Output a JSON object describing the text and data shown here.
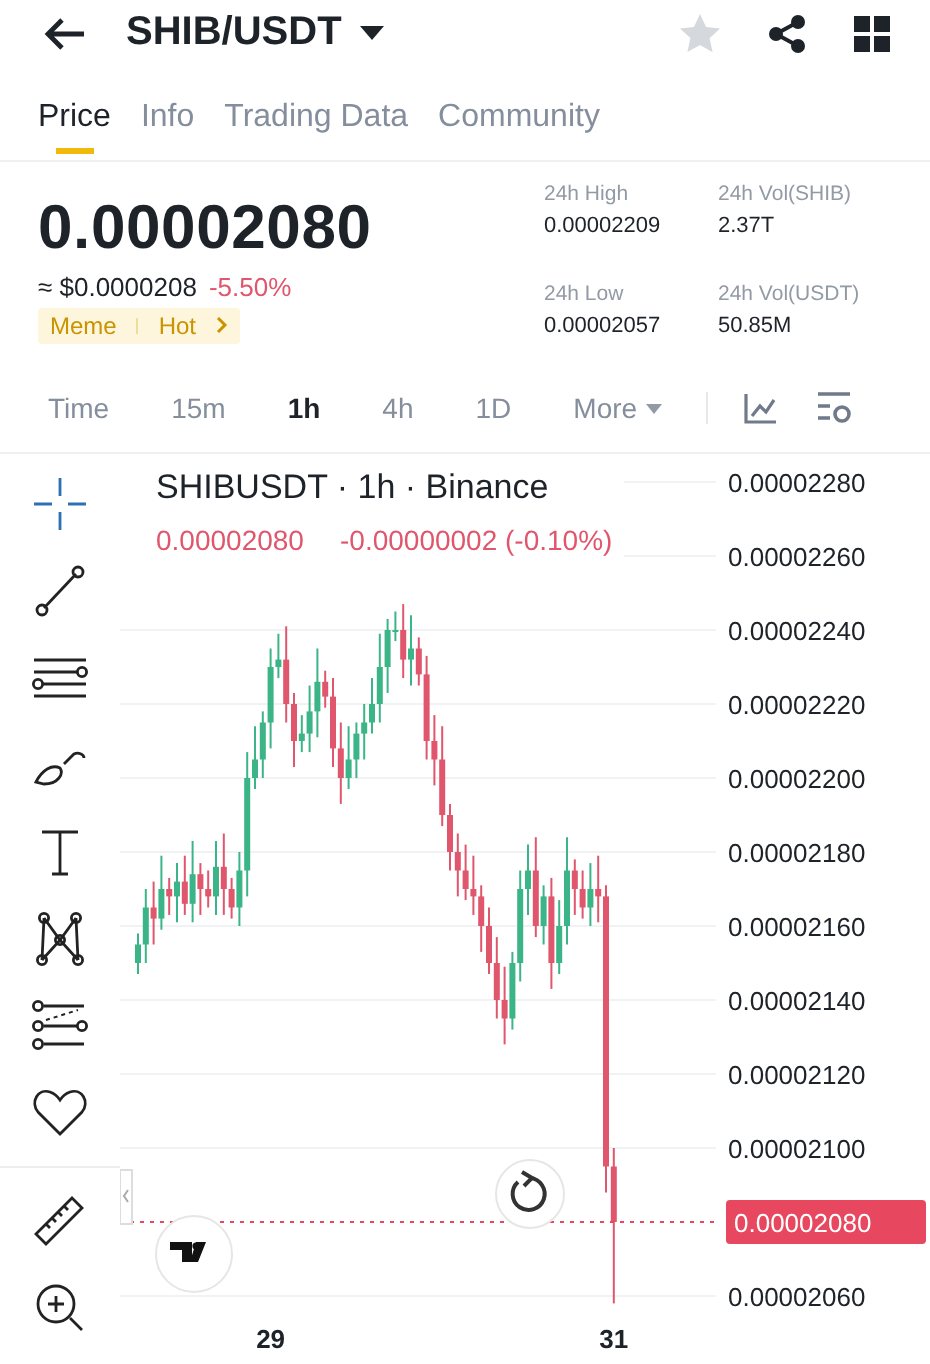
{
  "header": {
    "title": "SHIB/USDT",
    "favorite": false
  },
  "tabs": [
    {
      "label": "Price",
      "selected": true
    },
    {
      "label": "Info",
      "selected": false
    },
    {
      "label": "Trading Data",
      "selected": false
    },
    {
      "label": "Community",
      "selected": false
    }
  ],
  "price": {
    "last": "0.00002080",
    "fiat": "≈ $0.0000208",
    "change": "-5.50%",
    "tags": [
      "Meme",
      "Hot"
    ]
  },
  "stats": [
    {
      "label": "24h High",
      "value": "0.00002209"
    },
    {
      "label": "24h Vol(SHIB)",
      "value": "2.37T"
    },
    {
      "label": "24h Low",
      "value": "0.00002057"
    },
    {
      "label": "24h Vol(USDT)",
      "value": "50.85M"
    }
  ],
  "intervals": [
    {
      "label": "Time",
      "selected": false
    },
    {
      "label": "15m",
      "selected": false
    },
    {
      "label": "1h",
      "selected": true
    },
    {
      "label": "4h",
      "selected": false
    },
    {
      "label": "1D",
      "selected": false
    }
  ],
  "more": "More",
  "chart": {
    "legend_title": "SHIBUSDT · 1h · Binance",
    "legend_price": "0.00002080",
    "legend_change": "-0.00000002 (-0.10%)",
    "chart_data": {
      "type": "candlestick",
      "categories": [
        null,
        null,
        null,
        null,
        null,
        null,
        null,
        null,
        null,
        null,
        null,
        null,
        null,
        null,
        null,
        null,
        null,
        "29",
        null,
        null,
        null,
        null,
        null,
        null,
        null,
        null,
        null,
        null,
        null,
        null,
        null,
        null,
        null,
        null,
        null,
        null,
        null,
        null,
        null,
        null,
        null,
        null,
        null,
        null,
        null,
        null,
        null,
        null,
        null,
        null,
        null,
        null,
        null,
        null,
        null,
        null,
        null,
        null,
        null,
        null,
        null,
        "31"
      ],
      "ohlc": [
        [
          2.15e-05,
          2.158e-05,
          2.147e-05,
          2.155e-05
        ],
        [
          2.155e-05,
          2.17e-05,
          2.15e-05,
          2.165e-05
        ],
        [
          2.165e-05,
          2.172e-05,
          2.155e-05,
          2.162e-05
        ],
        [
          2.162e-05,
          2.179e-05,
          2.159e-05,
          2.17e-05
        ],
        [
          2.17e-05,
          2.173e-05,
          2.163e-05,
          2.168e-05
        ],
        [
          2.168e-05,
          2.177e-05,
          2.161e-05,
          2.172e-05
        ],
        [
          2.172e-05,
          2.179e-05,
          2.163e-05,
          2.166e-05
        ],
        [
          2.166e-05,
          2.183e-05,
          2.161e-05,
          2.174e-05
        ],
        [
          2.174e-05,
          2.177e-05,
          2.163e-05,
          2.17e-05
        ],
        [
          2.17e-05,
          2.175e-05,
          2.165e-05,
          2.168e-05
        ],
        [
          2.168e-05,
          2.183e-05,
          2.163e-05,
          2.176e-05
        ],
        [
          2.176e-05,
          2.185e-05,
          2.163e-05,
          2.17e-05
        ],
        [
          2.17e-05,
          2.173e-05,
          2.162e-05,
          2.165e-05
        ],
        [
          2.165e-05,
          2.18e-05,
          2.16e-05,
          2.175e-05
        ],
        [
          2.175e-05,
          2.207e-05,
          2.168e-05,
          2.2e-05
        ],
        [
          2.2e-05,
          2.214e-05,
          2.197e-05,
          2.205e-05
        ],
        [
          2.205e-05,
          2.218e-05,
          2.2e-05,
          2.215e-05
        ],
        [
          2.215e-05,
          2.235e-05,
          2.208e-05,
          2.23e-05
        ],
        [
          2.23e-05,
          2.239e-05,
          2.227e-05,
          2.232e-05
        ],
        [
          2.232e-05,
          2.241e-05,
          2.215e-05,
          2.22e-05
        ],
        [
          2.22e-05,
          2.223e-05,
          2.203e-05,
          2.21e-05
        ],
        [
          2.21e-05,
          2.217e-05,
          2.207e-05,
          2.212e-05
        ],
        [
          2.212e-05,
          2.225e-05,
          2.207e-05,
          2.218e-05
        ],
        [
          2.218e-05,
          2.235e-05,
          2.211e-05,
          2.226e-05
        ],
        [
          2.226e-05,
          2.229e-05,
          2.219e-05,
          2.222e-05
        ],
        [
          2.222e-05,
          2.227e-05,
          2.203e-05,
          2.208e-05
        ],
        [
          2.208e-05,
          2.215e-05,
          2.193e-05,
          2.2e-05
        ],
        [
          2.2e-05,
          2.214e-05,
          2.197e-05,
          2.205e-05
        ],
        [
          2.205e-05,
          2.215e-05,
          2.2e-05,
          2.212e-05
        ],
        [
          2.212e-05,
          2.22e-05,
          2.205e-05,
          2.215e-05
        ],
        [
          2.215e-05,
          2.227e-05,
          2.212e-05,
          2.22e-05
        ],
        [
          2.22e-05,
          2.239e-05,
          2.215e-05,
          2.23e-05
        ],
        [
          2.23e-05,
          2.243e-05,
          2.223e-05,
          2.24e-05
        ],
        [
          2.24e-05,
          2.245e-05,
          2.237e-05,
          2.24e-05
        ],
        [
          2.24e-05,
          2.247e-05,
          2.227e-05,
          2.232e-05
        ],
        [
          2.232e-05,
          2.244e-05,
          2.225e-05,
          2.235e-05
        ],
        [
          2.235e-05,
          2.238e-05,
          2.225e-05,
          2.228e-05
        ],
        [
          2.228e-05,
          2.233e-05,
          2.205e-05,
          2.21e-05
        ],
        [
          2.21e-05,
          2.217e-05,
          2.198e-05,
          2.205e-05
        ],
        [
          2.205e-05,
          2.214e-05,
          2.187e-05,
          2.19e-05
        ],
        [
          2.19e-05,
          2.193e-05,
          2.175e-05,
          2.18e-05
        ],
        [
          2.18e-05,
          2.185e-05,
          2.168e-05,
          2.175e-05
        ],
        [
          2.175e-05,
          2.182e-05,
          2.167e-05,
          2.17e-05
        ],
        [
          2.17e-05,
          2.179e-05,
          2.163e-05,
          2.168e-05
        ],
        [
          2.168e-05,
          2.171e-05,
          2.153e-05,
          2.16e-05
        ],
        [
          2.16e-05,
          2.165e-05,
          2.147e-05,
          2.15e-05
        ],
        [
          2.15e-05,
          2.157e-05,
          2.135e-05,
          2.14e-05
        ],
        [
          2.14e-05,
          2.149e-05,
          2.128e-05,
          2.135e-05
        ],
        [
          2.135e-05,
          2.153e-05,
          2.132e-05,
          2.15e-05
        ],
        [
          2.15e-05,
          2.175e-05,
          2.145e-05,
          2.17e-05
        ],
        [
          2.17e-05,
          2.182e-05,
          2.163e-05,
          2.175e-05
        ],
        [
          2.175e-05,
          2.184e-05,
          2.157e-05,
          2.16e-05
        ],
        [
          2.16e-05,
          2.171e-05,
          2.155e-05,
          2.168e-05
        ],
        [
          2.168e-05,
          2.173e-05,
          2.143e-05,
          2.15e-05
        ],
        [
          2.15e-05,
          2.167e-05,
          2.147e-05,
          2.16e-05
        ],
        [
          2.16e-05,
          2.184e-05,
          2.155e-05,
          2.175e-05
        ],
        [
          2.175e-05,
          2.178e-05,
          2.163e-05,
          2.17e-05
        ],
        [
          2.17e-05,
          2.175e-05,
          2.162e-05,
          2.165e-05
        ],
        [
          2.165e-05,
          2.177e-05,
          2.16e-05,
          2.17e-05
        ],
        [
          2.17e-05,
          2.179e-05,
          2.161e-05,
          2.168e-05
        ],
        [
          2.168e-05,
          2.171e-05,
          2.088e-05,
          2.095e-05
        ],
        [
          2.095e-05,
          2.1e-05,
          2.058e-05,
          2.08e-05
        ]
      ],
      "grid": true,
      "ylim": [
        2.06e-05,
        2.28e-05
      ],
      "ref_lines": [
        {
          "axis": "y",
          "value": 2.08e-05,
          "label": "0.00002080",
          "color": "#e8485f"
        }
      ],
      "yticks": [
        {
          "value": 2.28e-05,
          "label": "0.00002280"
        },
        {
          "value": 2.26e-05,
          "label": "0.00002260"
        },
        {
          "value": 2.24e-05,
          "label": "0.00002240"
        },
        {
          "value": 2.22e-05,
          "label": "0.00002220"
        },
        {
          "value": 2.2e-05,
          "label": "0.00002200"
        },
        {
          "value": 2.18e-05,
          "label": "0.00002180"
        },
        {
          "value": 2.16e-05,
          "label": "0.00002160"
        },
        {
          "value": 2.14e-05,
          "label": "0.00002140"
        },
        {
          "value": 2.12e-05,
          "label": "0.00002120"
        },
        {
          "value": 2.1e-05,
          "label": "0.00002100"
        },
        {
          "value": 2.06e-05,
          "label": "0.00002060"
        }
      ]
    }
  }
}
